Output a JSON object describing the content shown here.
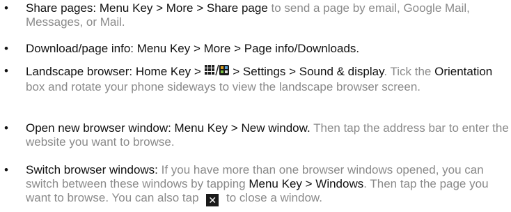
{
  "bullets": [
    {
      "lead": "Share pages: Menu Key > More > Share page",
      "rest": " to send a page by email, Google Mail, Messages, or Mail."
    },
    {
      "lead": "Download/page info: Menu Key > More > Page info/Downloads."
    },
    {
      "lead_a": "Landscape browser: Home Key > ",
      "lead_b": " > Settings > Sound & display",
      "rest_a": ". Tick the ",
      "orientation": "Orientation",
      "rest_b": " box and rotate your phone sideways to view the landscape browser screen."
    },
    {
      "lead": "Open new browser window: Menu Key > New window.",
      "rest": " Then tap the address bar to enter the website you want to browse."
    },
    {
      "lead": "Switch browser windows:",
      "rest_a": " If you have more than one browser windows opened, you can switch between these windows by tapping ",
      "menu_windows": "Menu Key > Windows",
      "rest_b": ". Then tap the page you want to browse. You can also tap ",
      "close_glyph": "✕",
      "rest_c": " to close a window."
    }
  ],
  "bullet_char": "•",
  "icons": {
    "apps": "apps-grid-icon",
    "close": "close-window-icon"
  },
  "colors": {
    "dark_text": "#111111",
    "grey_text": "#8a8a8a"
  }
}
